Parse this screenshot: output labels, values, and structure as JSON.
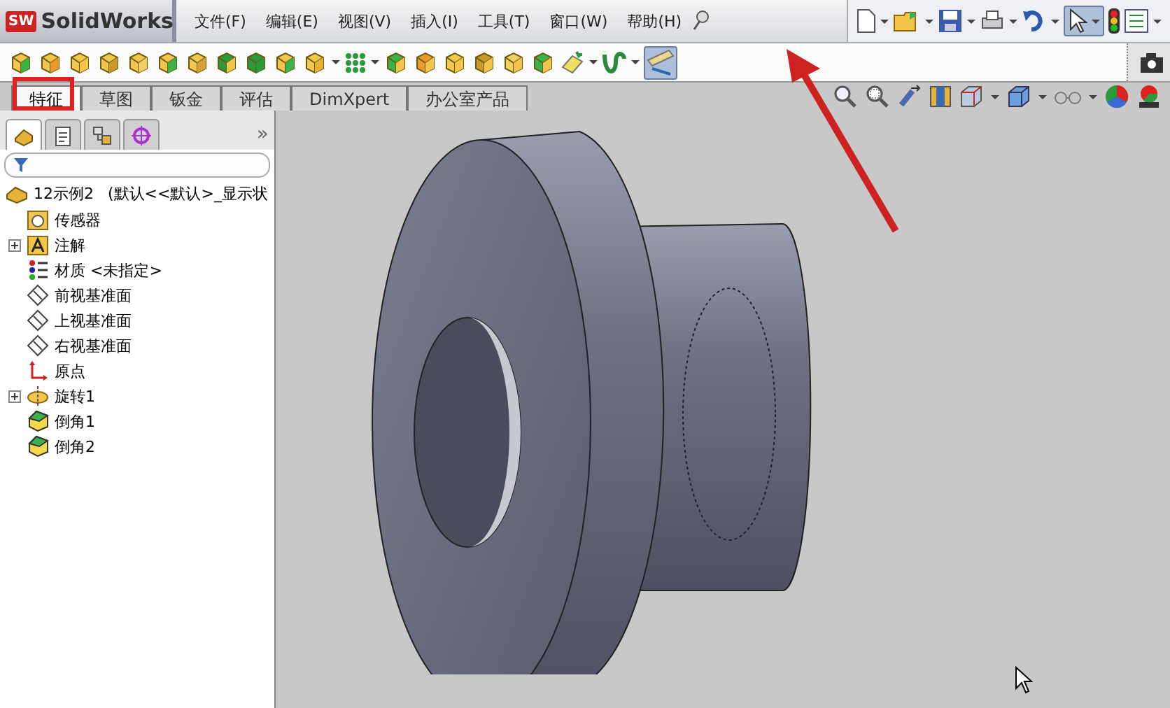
{
  "app": {
    "badge": "SW",
    "name": "SolidWorks"
  },
  "menu": [
    {
      "label": "文件(F)"
    },
    {
      "label": "编辑(E)"
    },
    {
      "label": "视图(V)"
    },
    {
      "label": "插入(I)"
    },
    {
      "label": "工具(T)"
    },
    {
      "label": "窗口(W)"
    },
    {
      "label": "帮助(H)"
    }
  ],
  "feature_tabs": [
    {
      "label": "特征",
      "selected": true
    },
    {
      "label": "草图",
      "selected": false
    },
    {
      "label": "钣金",
      "selected": false
    },
    {
      "label": "评估",
      "selected": false
    },
    {
      "label": "DimXpert",
      "selected": false
    },
    {
      "label": "办公室产品",
      "selected": false
    }
  ],
  "panel_tabs": [
    {
      "kind": "part",
      "selected": true
    },
    {
      "kind": "property",
      "selected": false
    },
    {
      "kind": "config",
      "selected": false
    },
    {
      "kind": "display",
      "selected": false
    }
  ],
  "panel_more": "»",
  "tree": {
    "root": {
      "label": "12示例2",
      "config": "(默认<<默认>_显示状"
    },
    "items": [
      {
        "kind": "sensor",
        "label": "传感器",
        "expandable": false
      },
      {
        "kind": "annotation",
        "label": "注解",
        "expandable": true
      },
      {
        "kind": "material",
        "label": "材质 <未指定>",
        "expandable": false
      },
      {
        "kind": "plane",
        "label": "前视基准面",
        "expandable": false
      },
      {
        "kind": "plane",
        "label": "上视基准面",
        "expandable": false
      },
      {
        "kind": "plane",
        "label": "右视基准面",
        "expandable": false
      },
      {
        "kind": "origin",
        "label": "原点",
        "expandable": false
      },
      {
        "kind": "revolve",
        "label": "旋转1",
        "expandable": true
      },
      {
        "kind": "chamfer",
        "label": "倒角1",
        "expandable": false
      },
      {
        "kind": "chamfer",
        "label": "倒角2",
        "expandable": false
      }
    ]
  }
}
